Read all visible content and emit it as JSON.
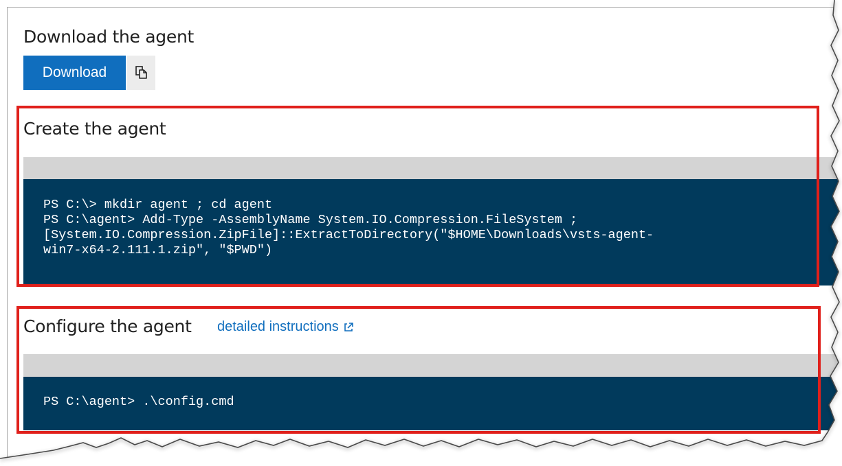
{
  "download_section": {
    "title": "Download the agent",
    "download_label": "Download",
    "copy_icon": "copy-icon"
  },
  "create_section": {
    "title": "Create the agent",
    "code_lines": [
      "PS C:\\> mkdir agent ; cd agent",
      "PS C:\\agent> Add-Type -AssemblyName System.IO.Compression.FileSystem ;",
      "[System.IO.Compression.ZipFile]::ExtractToDirectory(\"$HOME\\Downloads\\vsts-agent-",
      "win7-x64-2.111.1.zip\", \"$PWD\")"
    ]
  },
  "configure_section": {
    "title": "Configure the agent",
    "link_label": "detailed instructions",
    "link_icon": "external-link-icon",
    "code_lines": [
      "PS C:\\agent> .\\config.cmd"
    ]
  },
  "colors": {
    "accent": "#106ebe",
    "code_background": "#013a5c",
    "code_header": "#d4d4d4",
    "highlight": "#e0201b"
  }
}
